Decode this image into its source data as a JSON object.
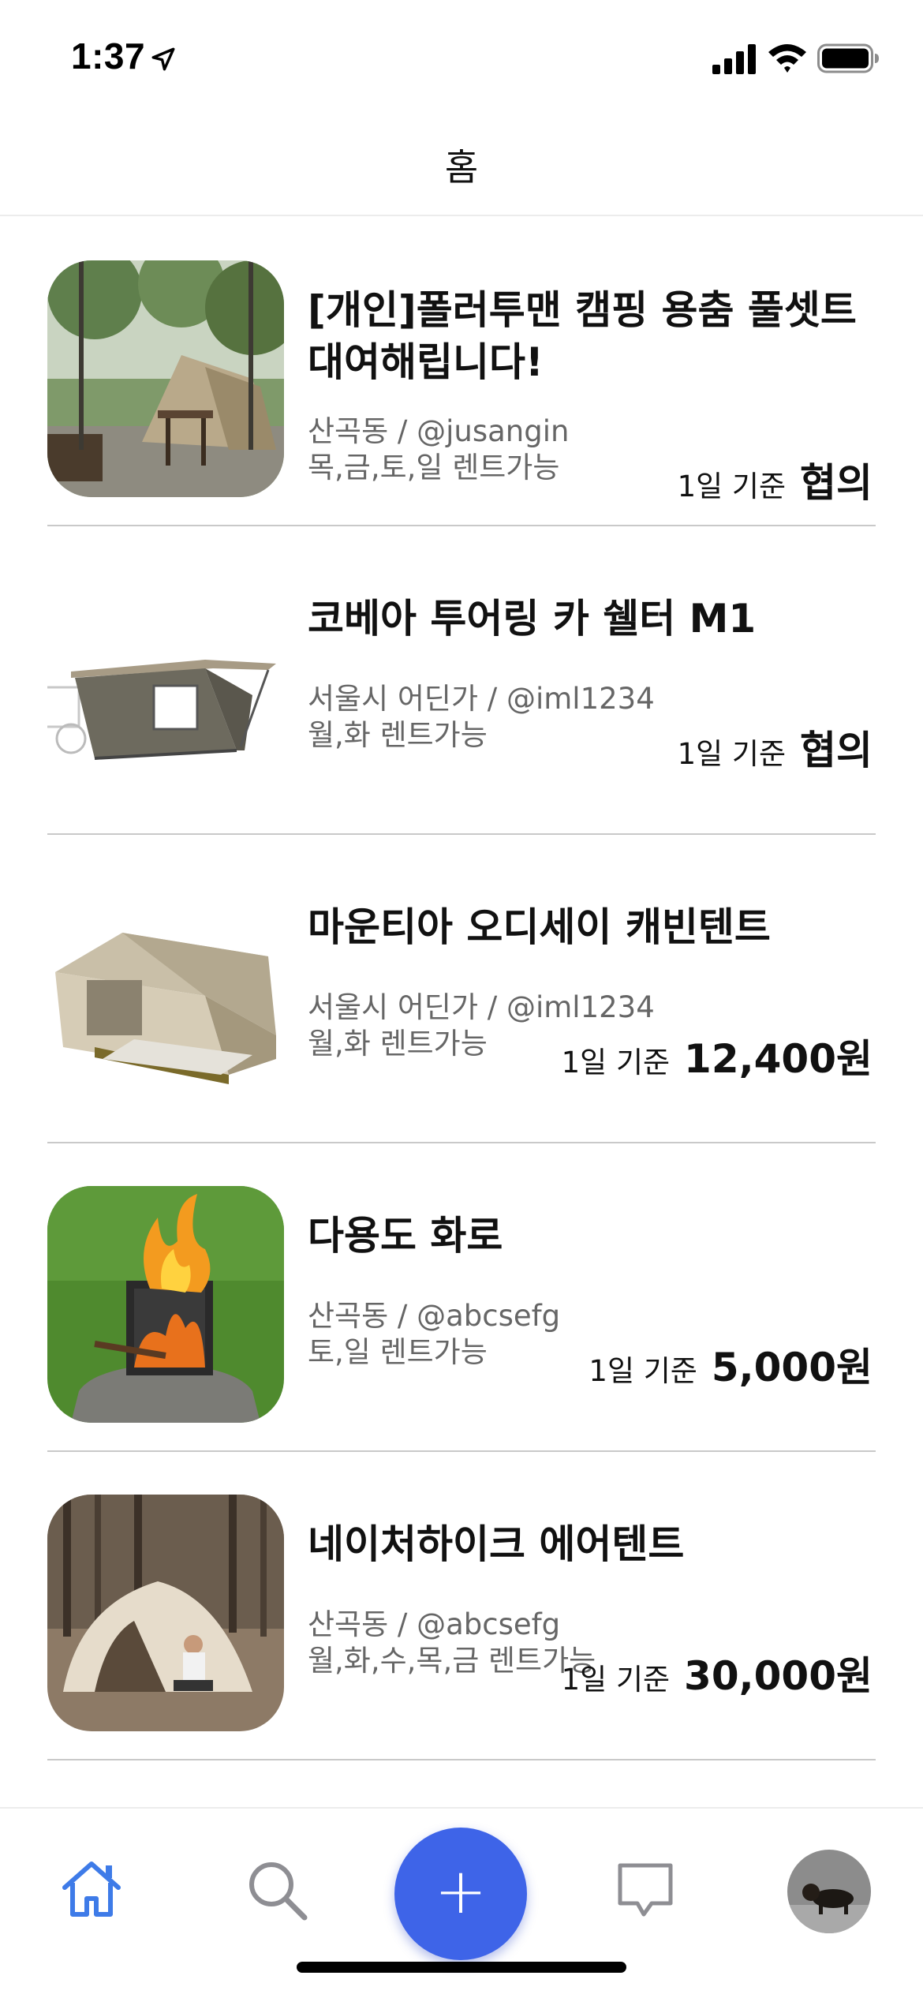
{
  "status_bar": {
    "time": "1:37"
  },
  "header": {
    "title": "홈"
  },
  "items": [
    {
      "title": "[개인]폴러투맨 캠핑 용춤 풀셋트 대여해립니다!",
      "location": "산곡동 / @jusangin",
      "days": "목,금,토,일 렌트가능",
      "price_unit": "1일 기준",
      "price": "협의"
    },
    {
      "title": "코베아 투어링 카 쉘터 M1",
      "location": "서울시 어딘가 / @iml1234",
      "days": "월,화 렌트가능",
      "price_unit": "1일 기준",
      "price": "협의"
    },
    {
      "title": "마운티아 오디세이 캐빈텐트",
      "location": "서울시 어딘가 / @iml1234",
      "days": "월,화 렌트가능",
      "price_unit": "1일 기준",
      "price": "12,400원"
    },
    {
      "title": "다용도 화로",
      "location": "산곡동 / @abcsefg",
      "days": "토,일 렌트가능",
      "price_unit": "1일 기준",
      "price": "5,000원"
    },
    {
      "title": "네이처하이크 에어텐트",
      "location": "산곡동 / @abcsefg",
      "days": "월,화,수,목,금 렌트가능",
      "price_unit": "1일 기준",
      "price": "30,000원"
    }
  ],
  "tab_bar": {
    "fab_label": "+",
    "icons": [
      "home-icon",
      "search-icon",
      "plus-icon",
      "chat-icon",
      "avatar"
    ]
  },
  "colors": {
    "accent": "#3e64e8",
    "home_active": "#3e7be8",
    "inactive_icon": "#8e8e93"
  }
}
